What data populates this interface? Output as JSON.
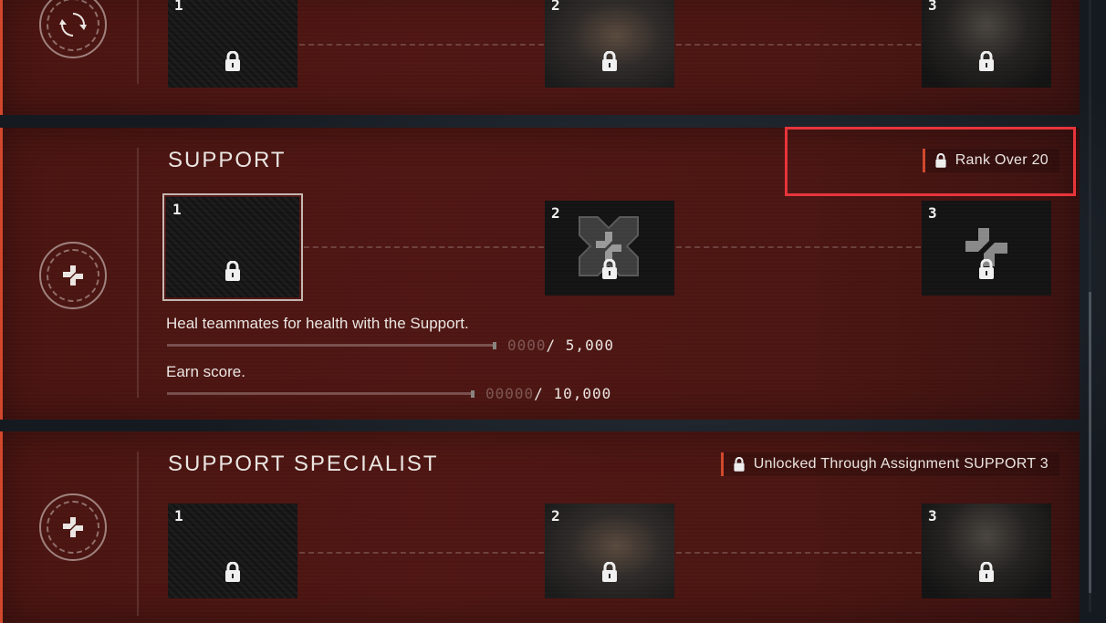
{
  "sections": [
    {
      "id": "top",
      "emblem_icon": "refresh-emblem-icon",
      "tiles": [
        {
          "num": "1",
          "style": "tex",
          "locked": true
        },
        {
          "num": "2",
          "style": "smoke",
          "locked": true
        },
        {
          "num": "3",
          "style": "portrait",
          "locked": true
        }
      ]
    },
    {
      "id": "support",
      "title": "SUPPORT",
      "emblem_icon": "support-emblem-icon",
      "requirement": "Rank Over 20",
      "tiles": [
        {
          "num": "1",
          "style": "tex",
          "locked": true,
          "selected": true
        },
        {
          "num": "2",
          "style": "support-icon",
          "locked": true
        },
        {
          "num": "3",
          "style": "support-icon",
          "locked": true
        }
      ],
      "objectives": [
        {
          "text": "Heal teammates for health with the Support.",
          "placeholder": "0000",
          "current": "",
          "total": "/ 5,000",
          "progress": 0
        },
        {
          "text": "Earn score.",
          "placeholder": "00000",
          "current": "",
          "total": "/ 10,000",
          "progress": 0
        }
      ]
    },
    {
      "id": "support-specialist",
      "title": "SUPPORT SPECIALIST",
      "emblem_icon": "support-emblem-icon",
      "requirement": "Unlocked Through Assignment SUPPORT 3",
      "tiles": [
        {
          "num": "1",
          "style": "tex",
          "locked": true
        },
        {
          "num": "2",
          "style": "smoke",
          "locked": true
        },
        {
          "num": "3",
          "style": "portrait",
          "locked": true
        }
      ]
    }
  ],
  "colors": {
    "accent": "#d2482c",
    "highlight": "#e8343b",
    "panel": "#4a1411"
  }
}
